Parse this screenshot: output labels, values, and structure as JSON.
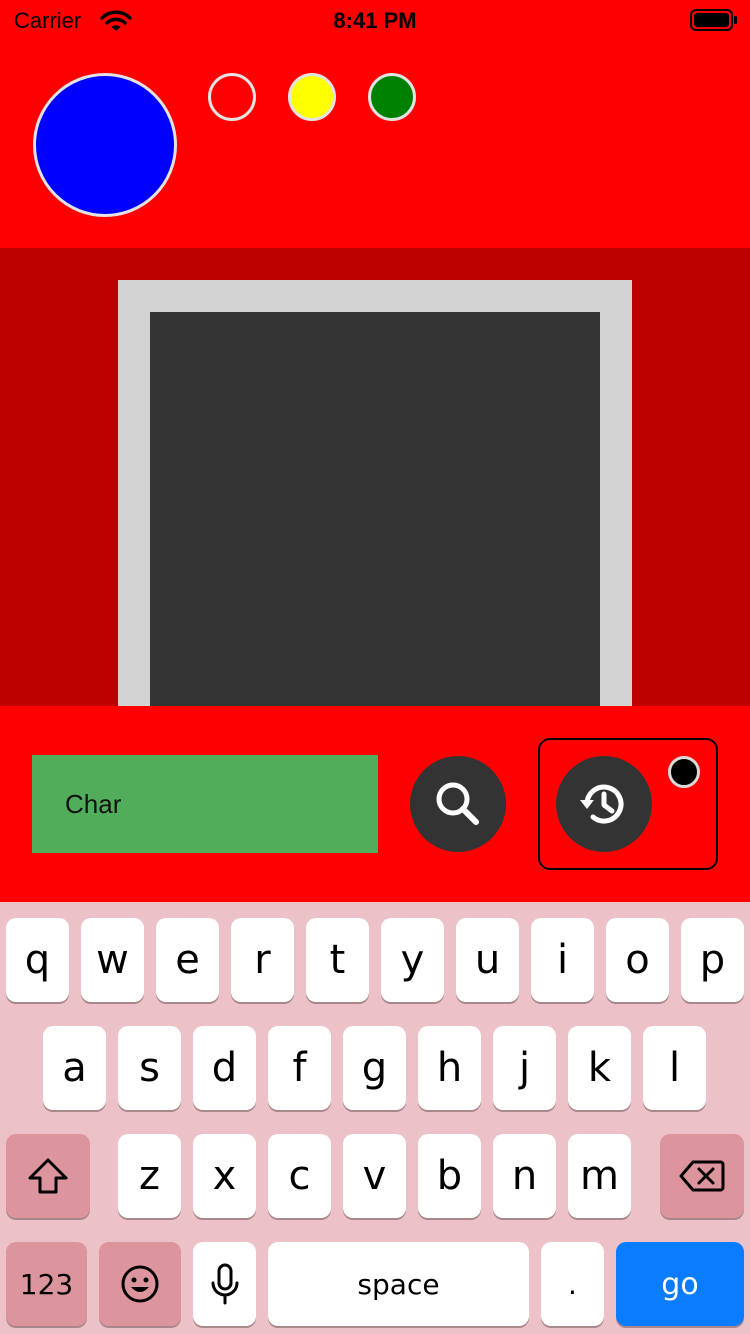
{
  "status_bar": {
    "carrier": "Carrier",
    "time": "8:41 PM",
    "icons": [
      "wifi-icon",
      "battery-icon"
    ]
  },
  "lights": {
    "main_color": "#0000ff",
    "small_colors": [
      "#ff0000",
      "#ffff00",
      "#008000"
    ]
  },
  "colors": {
    "background": "#ff0000",
    "screen_band": "#bd0000",
    "screen_frame": "#d3d3d3",
    "screen": "#333333",
    "search_field": "#52ad5b",
    "keyboard": "#ecc2c8",
    "go_key": "#0a7cff"
  },
  "search": {
    "value": "Char",
    "button_icon": "search-icon"
  },
  "history": {
    "button_icon": "history-icon"
  },
  "keyboard": {
    "row1": [
      "q",
      "w",
      "e",
      "r",
      "t",
      "y",
      "u",
      "i",
      "o",
      "p"
    ],
    "row2": [
      "a",
      "s",
      "d",
      "f",
      "g",
      "h",
      "j",
      "k",
      "l"
    ],
    "row3": [
      "z",
      "x",
      "c",
      "v",
      "b",
      "n",
      "m"
    ],
    "numbers_label": "123",
    "space_label": "space",
    "period_label": ".",
    "go_label": "go",
    "icons": [
      "shift-icon",
      "backspace-icon",
      "emoji-icon",
      "microphone-icon"
    ]
  }
}
